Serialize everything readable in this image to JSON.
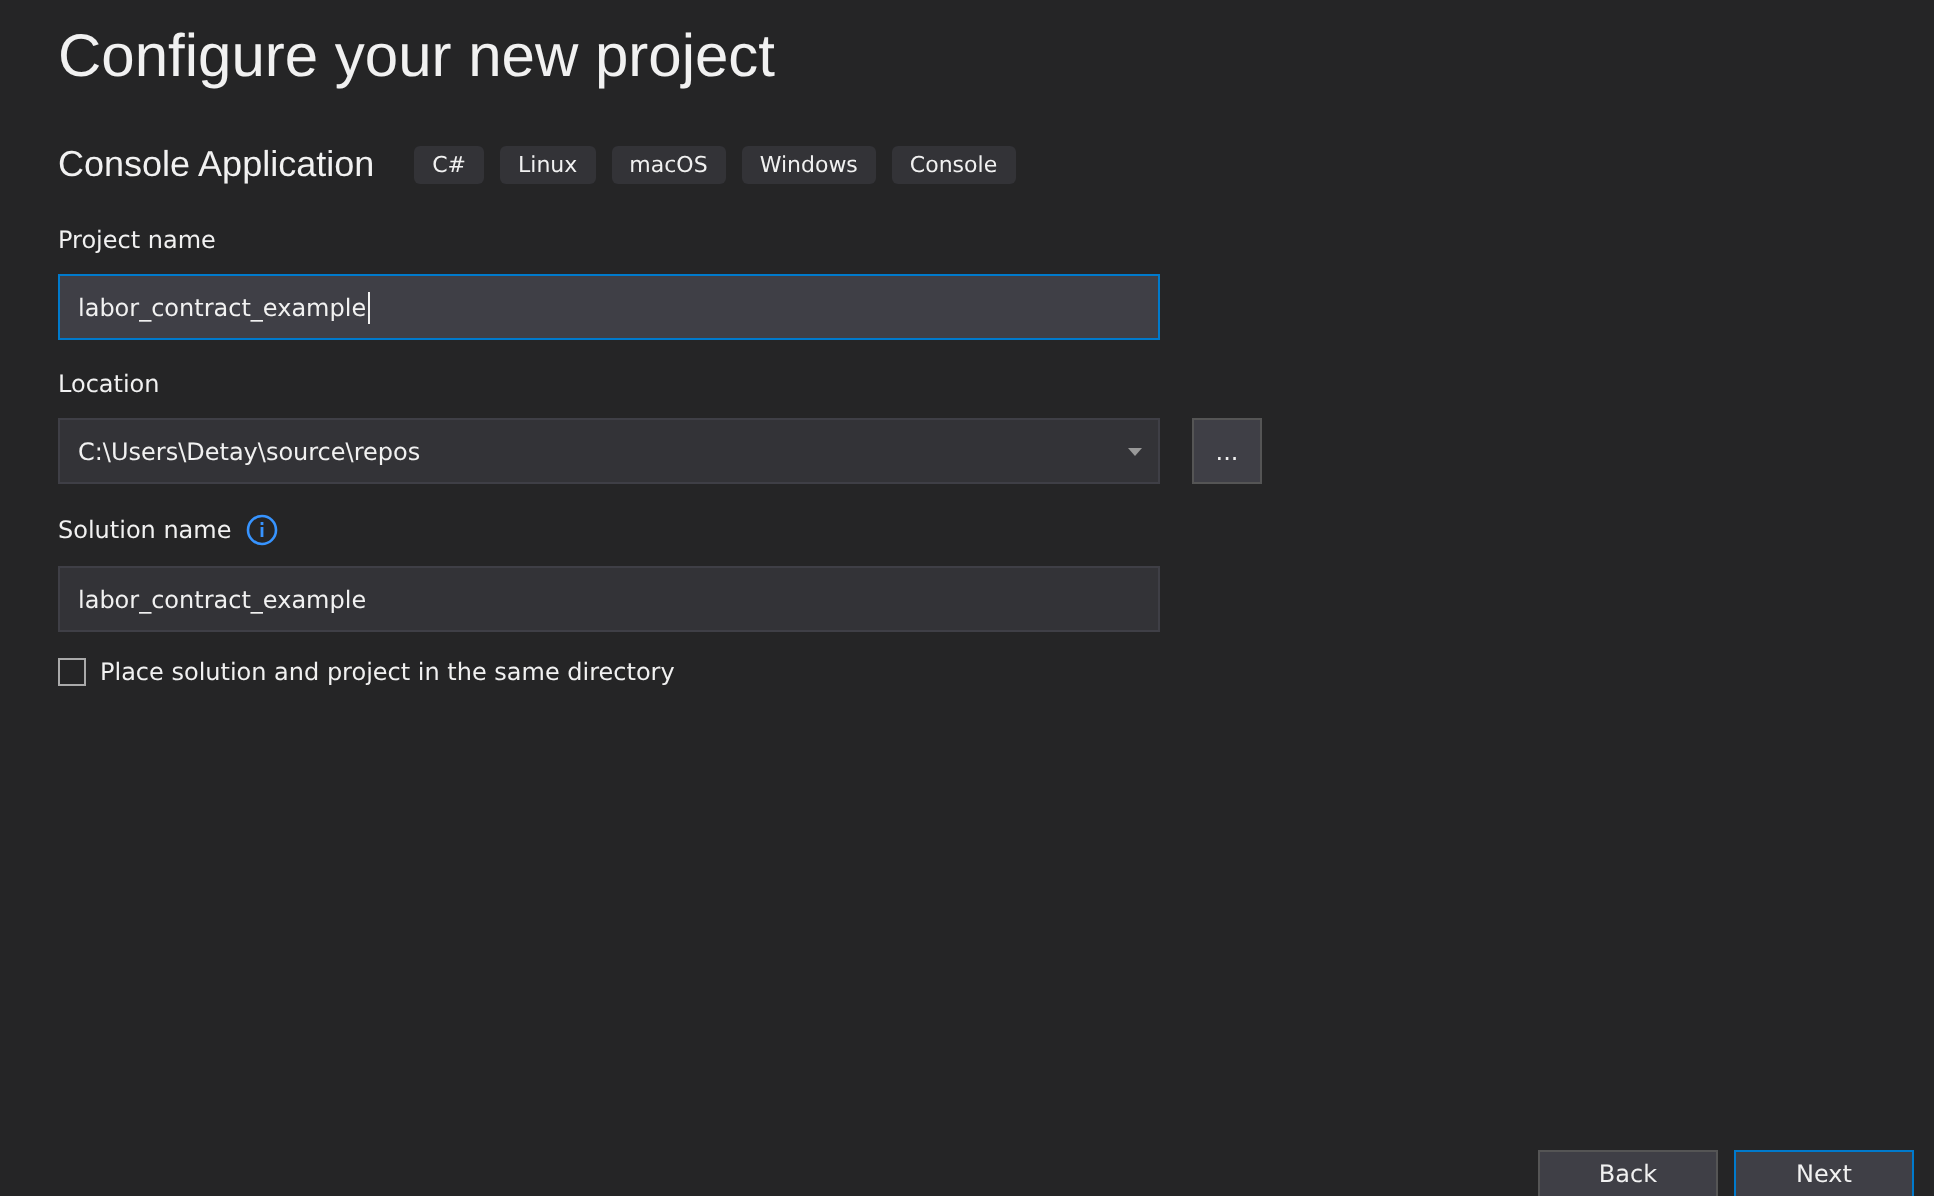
{
  "title": "Configure your new project",
  "template": {
    "name": "Console Application",
    "tags": [
      "C#",
      "Linux",
      "macOS",
      "Windows",
      "Console"
    ]
  },
  "fields": [
    {
      "kind": "text",
      "label": "Project name",
      "value": "labor_contract_example",
      "focused": true
    },
    {
      "kind": "dropdown",
      "label": "Location",
      "value": "C:\\Users\\Detay\\source\\repos",
      "focused": false,
      "browse_button": "..."
    },
    {
      "kind": "text",
      "label": "Solution name",
      "value": "labor_contract_example",
      "focused": false,
      "info": true
    }
  ],
  "checkbox": {
    "label": "Place solution and project in the same directory",
    "checked": false
  },
  "buttons": [
    {
      "label": "Back",
      "focused": false
    },
    {
      "label": "Next",
      "focused": true
    }
  ]
}
